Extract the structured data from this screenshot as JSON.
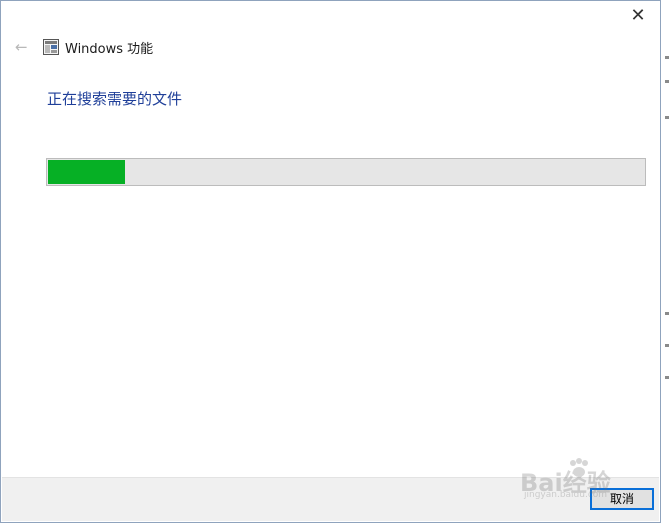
{
  "window": {
    "title": "Windows 功能",
    "close_glyph": "✕",
    "back_glyph": "←"
  },
  "content": {
    "heading": "正在搜索需要的文件",
    "progress_percent": 13
  },
  "footer": {
    "cancel_label": "取消"
  },
  "watermark": {
    "text": "Bai经验",
    "subtext": "jingyan.baidu.com"
  },
  "colors": {
    "accent_heading": "#1f3f99",
    "progress_fill": "#06b025",
    "progress_track": "#e6e6e6",
    "button_focus_border": "#0a6fd8"
  },
  "icons": {
    "back": "back-arrow-icon",
    "app": "windows-features-icon",
    "close": "close-icon"
  }
}
